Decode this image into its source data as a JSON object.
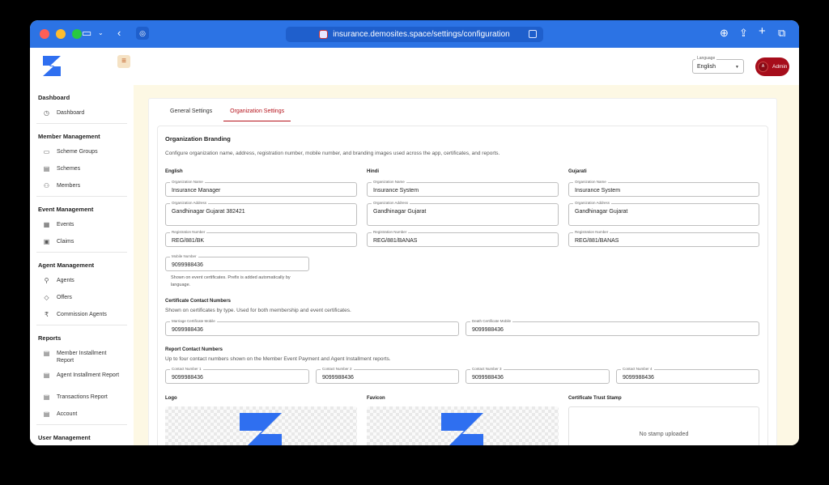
{
  "browser": {
    "url": "insurance.demosites.space/settings/configuration",
    "traffic_colors": [
      "#ff5f57",
      "#febc2e",
      "#28c840"
    ]
  },
  "sidebar": {
    "sections": [
      {
        "title": "Dashboard",
        "items": [
          {
            "label": "Dashboard",
            "icon": "dashboard-icon"
          }
        ]
      },
      {
        "title": "Member Management",
        "items": [
          {
            "label": "Scheme Groups",
            "icon": "folder-icon"
          },
          {
            "label": "Schemes",
            "icon": "document-icon"
          },
          {
            "label": "Members",
            "icon": "users-icon"
          }
        ]
      },
      {
        "title": "Event Management",
        "items": [
          {
            "label": "Events",
            "icon": "calendar-icon"
          },
          {
            "label": "Claims",
            "icon": "claims-icon"
          }
        ]
      },
      {
        "title": "Agent Management",
        "items": [
          {
            "label": "Agents",
            "icon": "agent-icon"
          },
          {
            "label": "Offers",
            "icon": "tag-icon"
          },
          {
            "label": "Commission Agents",
            "icon": "rupee-icon"
          }
        ]
      },
      {
        "title": "Reports",
        "items": [
          {
            "label": "Member Installment Report",
            "icon": "report-icon"
          },
          {
            "label": "Agent Installment Report",
            "icon": "report-icon"
          },
          {
            "label": "Transactions Report",
            "icon": "report-icon"
          },
          {
            "label": "Account",
            "icon": "report-icon"
          }
        ]
      },
      {
        "title": "User Management",
        "items": []
      }
    ]
  },
  "header": {
    "language_label": "Language",
    "language_value": "English",
    "admin_initial": "A",
    "admin_label": "Admin",
    "accent": "#b5121b"
  },
  "tabs": [
    {
      "label": "General Settings",
      "active": false
    },
    {
      "label": "Organization Settings",
      "active": true
    }
  ],
  "branding": {
    "title": "Organization Branding",
    "description": "Configure organization name, address, registration number, mobile number, and branding images used across the app, certificates, and reports.",
    "columns": [
      {
        "heading": "English",
        "org_name_label": "Organization Name",
        "org_name": "Insurance Manager",
        "address_label": "Organization Address",
        "address": "Gandhinagar Gujarat 382421",
        "reg_label": "Registration Number",
        "reg": "REG/881/BK"
      },
      {
        "heading": "Hindi",
        "org_name_label": "Organization Name",
        "org_name": "Insurance System",
        "address_label": "Organization Address",
        "address": "Gandhinagar Gujarat",
        "reg_label": "Registration Number",
        "reg": "REG/881/BANAS"
      },
      {
        "heading": "Gujarati",
        "org_name_label": "Organization Name",
        "org_name": "Insurance System",
        "address_label": "Organization Address",
        "address": "Gandhinagar Gujarat",
        "reg_label": "Registration Number",
        "reg": "REG/881/BANAS"
      }
    ],
    "mobile_label": "Mobile Number",
    "mobile": "9099988436",
    "mobile_helper": "Shown on event certificates. Prefix is added automatically by language."
  },
  "certificate_contacts": {
    "title": "Certificate Contact Numbers",
    "description": "Shown on certificates by type. Used for both membership and event certificates.",
    "marriage_label": "Marriage Certificate Mobile",
    "marriage": "9099988436",
    "death_label": "Death Certificate Mobile",
    "death": "9099988436"
  },
  "report_contacts": {
    "title": "Report Contact Numbers",
    "description": "Up to four contact numbers shown on the Member Event Payment and Agent Installment reports.",
    "items": [
      {
        "label": "Contact Number 1",
        "value": "9099988436"
      },
      {
        "label": "Contact Number 2",
        "value": "9099988436"
      },
      {
        "label": "Contact Number 3",
        "value": "9099988436"
      },
      {
        "label": "Contact Number 4",
        "value": "9099988436"
      }
    ]
  },
  "images": {
    "logo_label": "Logo",
    "favicon_label": "Favicon",
    "stamp_label": "Certificate Trust Stamp",
    "stamp_empty": "No stamp uploaded",
    "brand_color": "#2f6ff0"
  }
}
